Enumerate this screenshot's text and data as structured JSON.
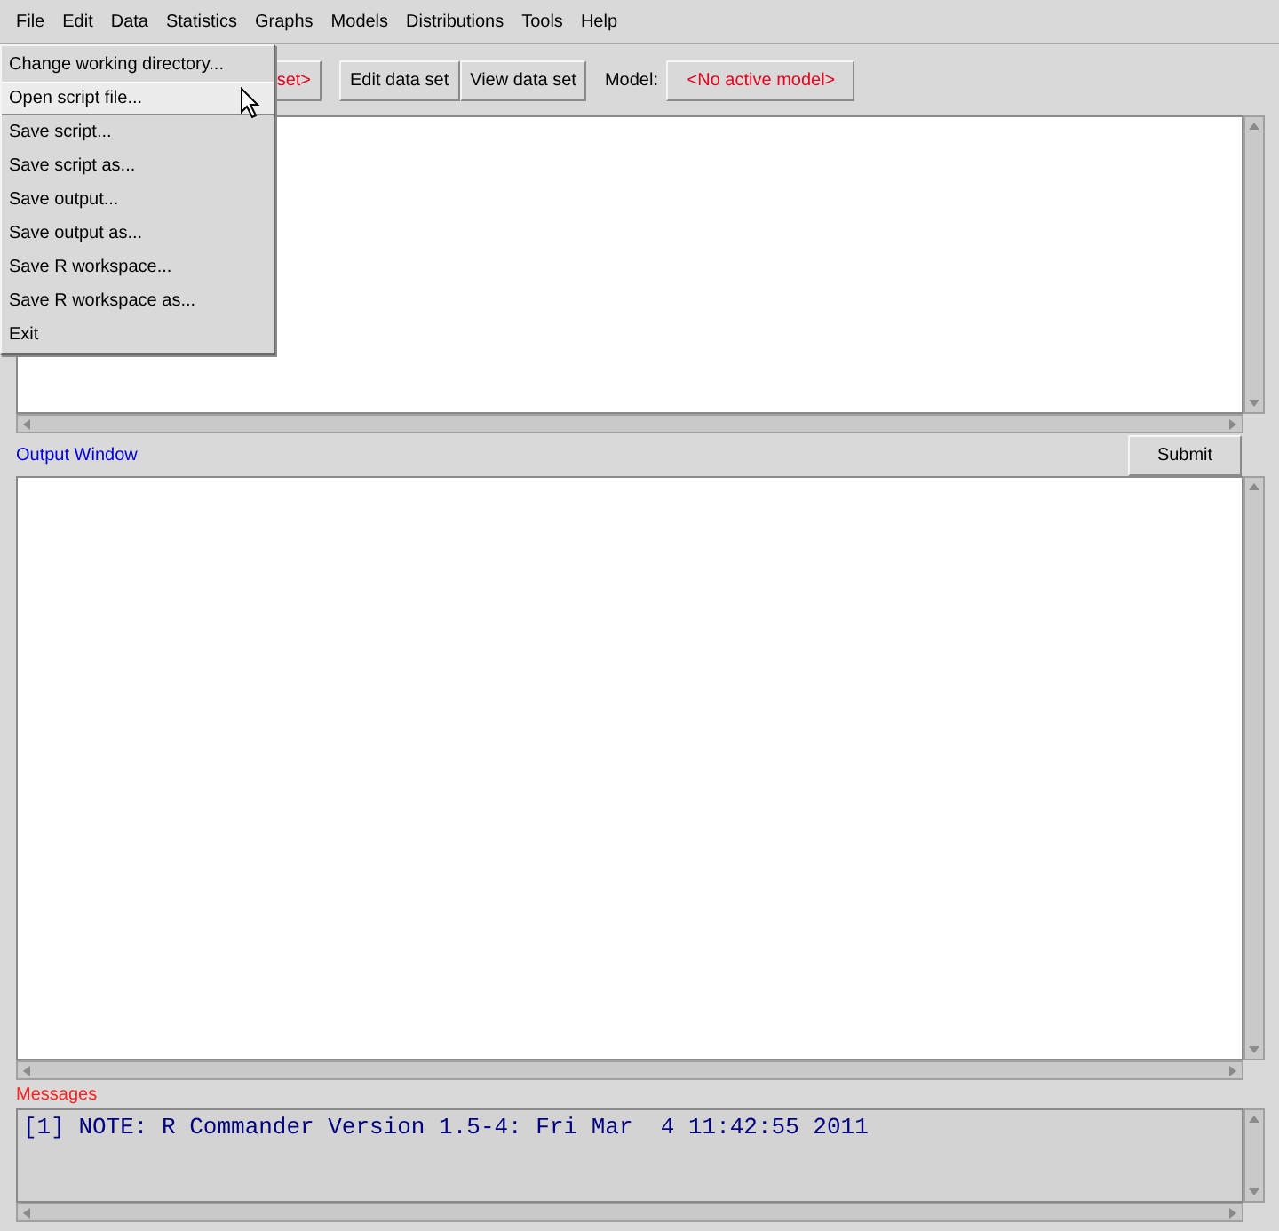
{
  "menubar": [
    "File",
    "Edit",
    "Data",
    "Statistics",
    "Graphs",
    "Models",
    "Distributions",
    "Tools",
    "Help"
  ],
  "file_menu": [
    {
      "label": "Change working directory...",
      "selected": false
    },
    {
      "label": "Open script file...",
      "selected": true
    },
    {
      "label": "Save script...",
      "selected": false
    },
    {
      "label": "Save script as...",
      "selected": false
    },
    {
      "label": "Save output...",
      "selected": false
    },
    {
      "label": "Save output as...",
      "selected": false
    },
    {
      "label": "Save R workspace...",
      "selected": false
    },
    {
      "label": "Save R workspace as...",
      "selected": false
    },
    {
      "label": "Exit",
      "selected": false
    }
  ],
  "toolbar": {
    "data_set_button": "set>",
    "edit_button": "Edit data set",
    "view_button": "View data set",
    "model_label": "Model:",
    "model_button": "<No active model>"
  },
  "output": {
    "title": "Output Window",
    "submit": "Submit"
  },
  "messages": {
    "title": "Messages",
    "lines": [
      "[1] NOTE: R Commander Version 1.5-4: Fri Mar  4 11:42:55 2011"
    ]
  }
}
